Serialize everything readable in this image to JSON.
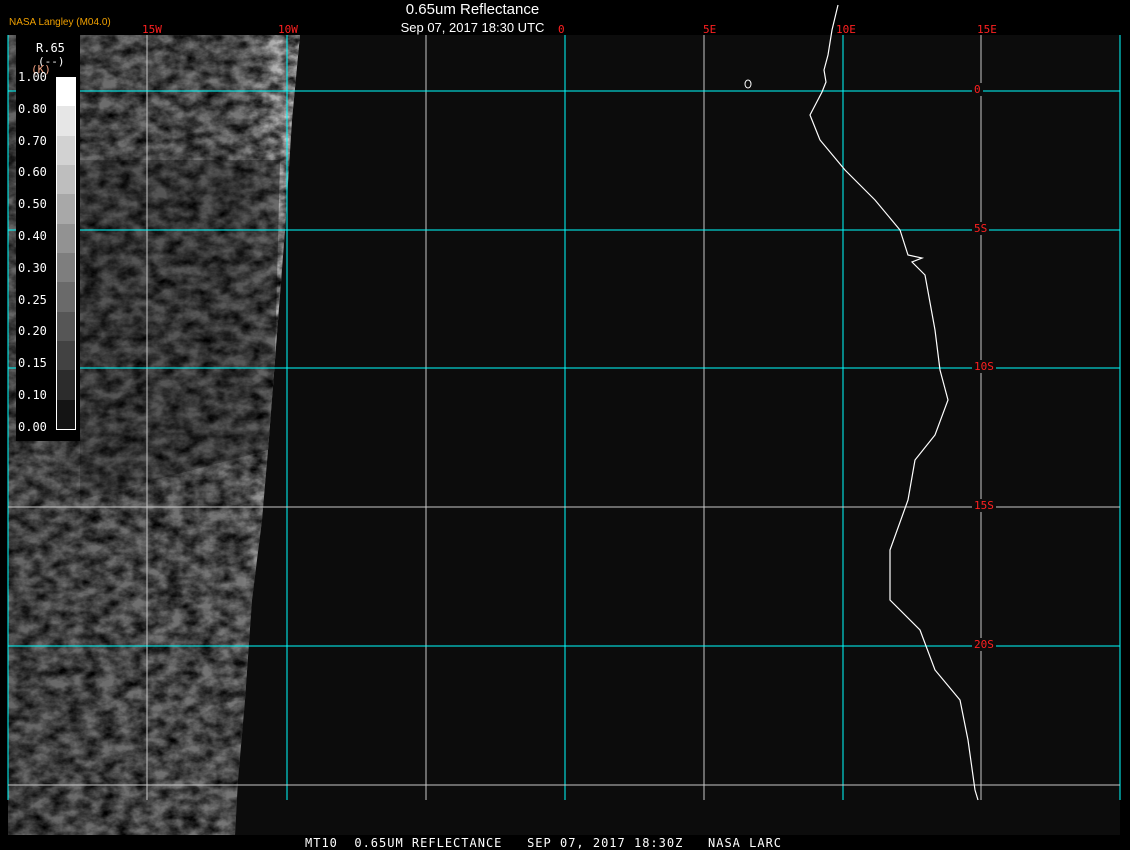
{
  "header": {
    "title": "0.65um Reflectance",
    "datetime": "Sep 07, 2017 18:30 UTC",
    "credit": "NASA Langley (M04.0)"
  },
  "lon_labels": [
    "15W",
    "10W",
    "0",
    "5E",
    "10E",
    "15E"
  ],
  "lat_labels": [
    "0",
    "5S",
    "10S",
    "15S",
    "20S"
  ],
  "legend": {
    "title": "R.65",
    "unit": "(--)",
    "unit2": "(K)",
    "ticks": [
      "1.00",
      "0.80",
      "0.70",
      "0.60",
      "0.50",
      "0.40",
      "0.30",
      "0.25",
      "0.20",
      "0.15",
      "0.10",
      "0.00"
    ],
    "colors": [
      "#ffffff",
      "#e6e6e6",
      "#d2d2d2",
      "#bebebe",
      "#a8a8a8",
      "#929292",
      "#7e7e7e",
      "#6a6a6a",
      "#565656",
      "#424242",
      "#2c2c2c",
      "#141414"
    ]
  },
  "footer": "MT10  0.65UM REFLECTANCE   SEP 07, 2017 18:30Z   NASA LARC",
  "colors": {
    "grid_primary": "#00ffff",
    "grid_secondary": "#c8c8c8",
    "label": "#ff2020",
    "background": "#0c0c0c"
  }
}
